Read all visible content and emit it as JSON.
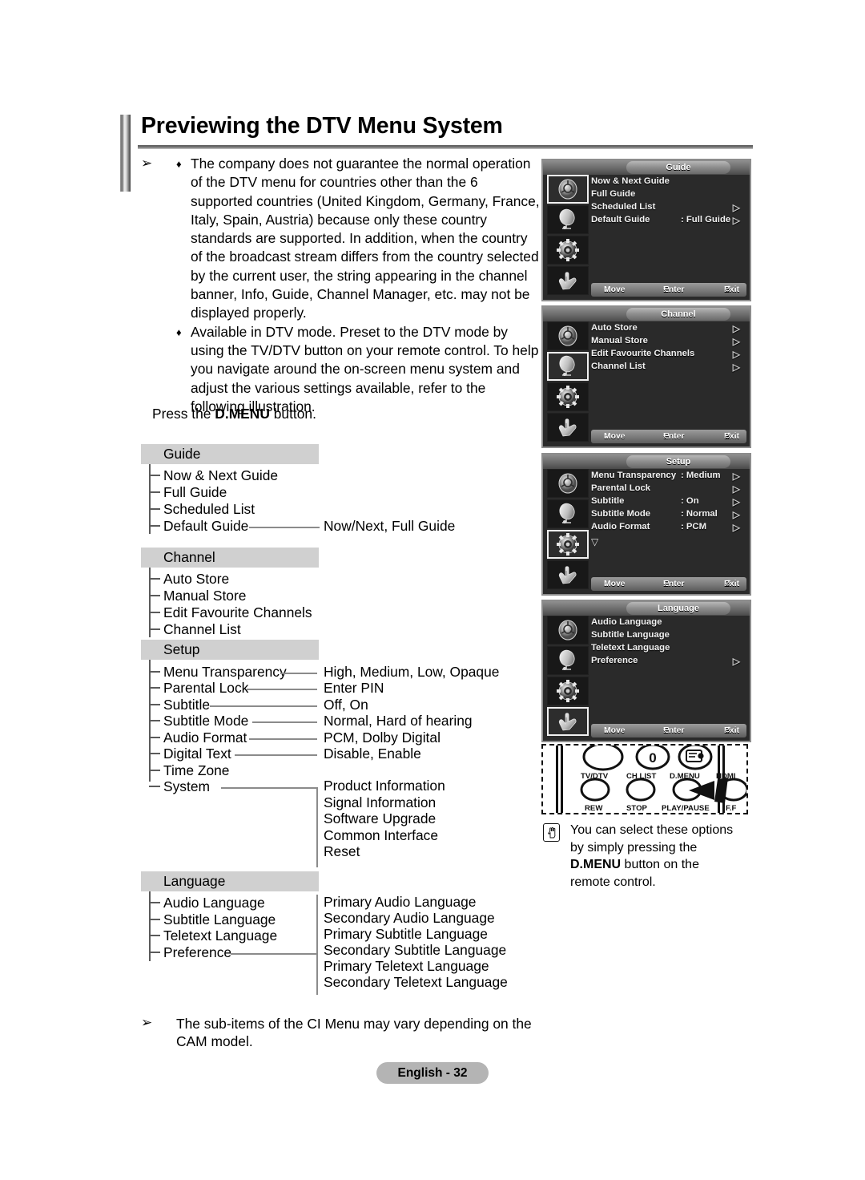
{
  "page": {
    "title": "Previewing the DTV Menu System",
    "footer_badge": "English - 32"
  },
  "intro": {
    "arrow_glyph": "➢",
    "bullet_glyph": "♦",
    "bullets": [
      "The company does not guarantee the normal operation of the DTV menu for countries other than the 6 supported countries (United Kingdom, Germany, France, Italy, Spain, Austria) because only these country standards are supported. In addition, when the country of the broadcast stream differs from the country selected by the current user, the string appearing in the channel banner, Info, Guide, Channel Manager, etc. may not be displayed properly.",
      "Available in DTV mode. Preset to the DTV mode by using the TV/DTV button on your remote control. To help you navigate around the on-screen menu system and adjust the various settings available, refer to the following illustration."
    ],
    "press_prefix": "Press the ",
    "press_bold": "D.MENU",
    "press_suffix": " button."
  },
  "tree": {
    "guide": {
      "header": "Guide",
      "items": [
        "Now & Next Guide",
        "Full Guide",
        "Scheduled List",
        "Default Guide"
      ],
      "default_guide_values": "Now/Next, Full Guide"
    },
    "channel": {
      "header": "Channel",
      "items": [
        "Auto Store",
        "Manual Store",
        "Edit Favourite Channels",
        "Channel List"
      ]
    },
    "setup": {
      "header": "Setup",
      "items": [
        "Menu Transparency",
        "Parental Lock",
        "Subtitle",
        "Subtitle Mode",
        "Audio Format",
        "Digital Text",
        "Time Zone",
        "System"
      ],
      "values": [
        "High, Medium, Low, Opaque",
        "Enter PIN",
        "Off, On",
        "Normal, Hard of hearing",
        "PCM, Dolby Digital",
        "Disable, Enable"
      ],
      "system_sub": [
        "Product Information",
        "Signal Information",
        "Software Upgrade",
        "Common Interface",
        "Reset"
      ]
    },
    "language": {
      "header": "Language",
      "items": [
        "Audio Language",
        "Subtitle Language",
        "Teletext Language",
        "Preference"
      ],
      "preference_sub": [
        "Primary Audio Language",
        "Secondary Audio Language",
        "Primary Subtitle Language",
        "Secondary Subtitle Language",
        "Primary Teletext Language",
        "Secondary Teletext Language"
      ]
    }
  },
  "osd": {
    "bottom_bar": {
      "move": "Move",
      "enter": "Enter",
      "exit": "Exit",
      "move_glyph": "↕",
      "enter_glyph": "↵",
      "exit_glyph": "↺"
    },
    "arrow_glyph": "▷",
    "down_glyph": "▽",
    "icons": [
      "guide-icon",
      "satellite-dish-icon",
      "gear-icon",
      "hand-remote-icon"
    ],
    "panels": [
      {
        "tab": "Guide",
        "selected_icon": 0,
        "rows": [
          {
            "label": "Now & Next Guide",
            "value": "",
            "arrow": false
          },
          {
            "label": "Full Guide",
            "value": "",
            "arrow": false
          },
          {
            "label": "Scheduled List",
            "value": "",
            "arrow": true
          },
          {
            "label": "Default Guide",
            "value": ": Full Guide",
            "arrow": true
          }
        ],
        "more": false
      },
      {
        "tab": "Channel",
        "selected_icon": 1,
        "rows": [
          {
            "label": "Auto Store",
            "value": "",
            "arrow": true
          },
          {
            "label": "Manual Store",
            "value": "",
            "arrow": true
          },
          {
            "label": "Edit Favourite Channels",
            "value": "",
            "arrow": true
          },
          {
            "label": "Channel List",
            "value": "",
            "arrow": true
          }
        ],
        "more": false
      },
      {
        "tab": "Setup",
        "selected_icon": 2,
        "rows": [
          {
            "label": "Menu Transparency",
            "value": ": Medium",
            "arrow": true
          },
          {
            "label": "Parental Lock",
            "value": "",
            "arrow": true
          },
          {
            "label": "Subtitle",
            "value": ": On",
            "arrow": true
          },
          {
            "label": "Subtitle  Mode",
            "value": ": Normal",
            "arrow": true
          },
          {
            "label": "Audio Format",
            "value": ": PCM",
            "arrow": true
          }
        ],
        "more": true
      },
      {
        "tab": "Language",
        "selected_icon": 3,
        "rows": [
          {
            "label": "Audio Language",
            "value": "",
            "arrow": false
          },
          {
            "label": "Subtitle Language",
            "value": "",
            "arrow": false
          },
          {
            "label": "Teletext Language",
            "value": "",
            "arrow": false
          },
          {
            "label": "Preference",
            "value": "",
            "arrow": true
          }
        ],
        "more": false
      }
    ]
  },
  "remote": {
    "zero_label": "0",
    "row1_labels": [
      "TV/DTV",
      "CH LIST",
      "D.MENU",
      "HDMI"
    ],
    "row2_labels": [
      "REW",
      "STOP",
      "PLAY/PAUSE",
      "F.F"
    ]
  },
  "side_note": {
    "line1": "You can select these options",
    "line2": "by simply pressing the",
    "bold": "D.MENU",
    "line3_suffix": " button on the",
    "line4": "remote control."
  },
  "bottom_note": {
    "arrow_glyph": "➢",
    "text": "The sub-items of the CI Menu may vary depending on the CAM model."
  }
}
